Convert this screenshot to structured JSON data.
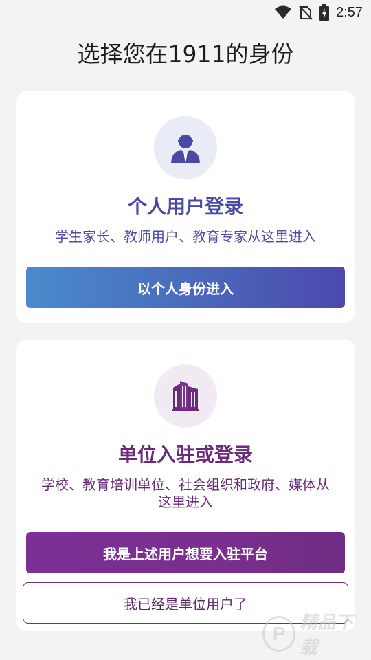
{
  "status_bar": {
    "time": "2:57",
    "icons": [
      "wifi-icon",
      "no-sim-icon",
      "battery-charging-icon"
    ]
  },
  "page": {
    "title": "选择您在1911的身份"
  },
  "personal_card": {
    "icon": "person-icon",
    "title": "个人用户登录",
    "description": "学生家长、教师用户、教育专家从这里进入",
    "button_label": "以个人身份进入"
  },
  "org_card": {
    "icon": "building-icon",
    "title": "单位入驻或登录",
    "description": "学校、教育培训单位、社会组织和政府、媒体从这里进入",
    "join_button_label": "我是上述用户想要入驻平台",
    "existing_button_label": "我已经是单位用户了"
  },
  "watermark": {
    "logo_letter": "P",
    "text": "精品下载"
  },
  "colors": {
    "personal_accent": "#4a4aa6",
    "org_accent": "#6b2a7a",
    "personal_button_gradient": [
      "#4a8bcb",
      "#4c48ad"
    ],
    "org_button": "#7a2f8f"
  }
}
